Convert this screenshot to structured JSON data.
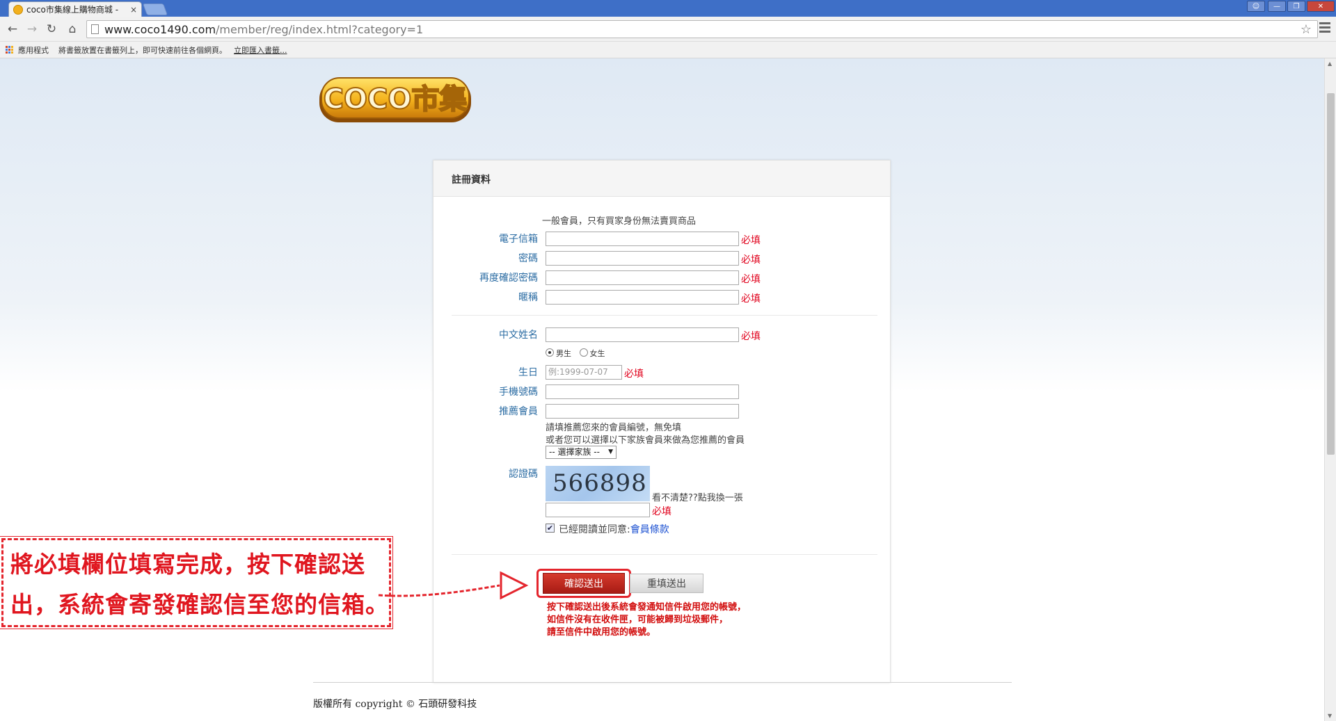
{
  "browser": {
    "tab_title": "coco市集線上購物商城 -",
    "tab_close": "×",
    "url_host": "www.coco1490.com",
    "url_path": "/member/reg/index.html?category=1",
    "bookmarks": {
      "apps_label": "應用程式",
      "hint": "將書籤放置在書籤列上，即可快速前往各個網頁。",
      "import_link": "立即匯入書籤..."
    }
  },
  "logo_text": "COCO市集",
  "form": {
    "header": "註冊資料",
    "member_note": "一般會員，只有買家身份無法賣買商品",
    "required": "必填",
    "fields": {
      "email": "電子信箱",
      "password": "密碼",
      "confirm_password": "再度確認密碼",
      "nickname": "暱稱",
      "chinese_name": "中文姓名",
      "gender_male": "男生",
      "gender_female": "女生",
      "birthday": "生日",
      "birthday_placeholder": "例:1999-07-07",
      "mobile": "手機號碼",
      "referrer": "推薦會員",
      "referrer_note1": "請填推薦您來的會員編號，無免填",
      "referrer_note2": "或者您可以選擇以下家族會員來做為您推薦的會員",
      "family_select": "-- 選擇家族 --",
      "captcha": "認證碼",
      "captcha_value": "566898",
      "captcha_refresh": "看不清楚??點我換一張",
      "agree_prefix": "已經閱讀並同意:",
      "agree_link": "會員條款"
    },
    "buttons": {
      "submit": "確認送出",
      "reset": "重填送出"
    },
    "notice": [
      "按下確認送出後系統會發通知信件啟用您的帳號，",
      "如信件沒有在收件匣，可能被歸到垃圾郵件，",
      "請至信件中啟用您的帳號。"
    ]
  },
  "annotation": {
    "line1": "將必填欄位填寫完成，按下確認送",
    "line2": "出，系統會寄發確認信至您的信箱。"
  },
  "footer": "版權所有 copyright © 石頭研發科技",
  "colors": {
    "label_blue": "#2b6ca3",
    "required_red": "#e0001b",
    "annotation_red": "#e4252d"
  }
}
